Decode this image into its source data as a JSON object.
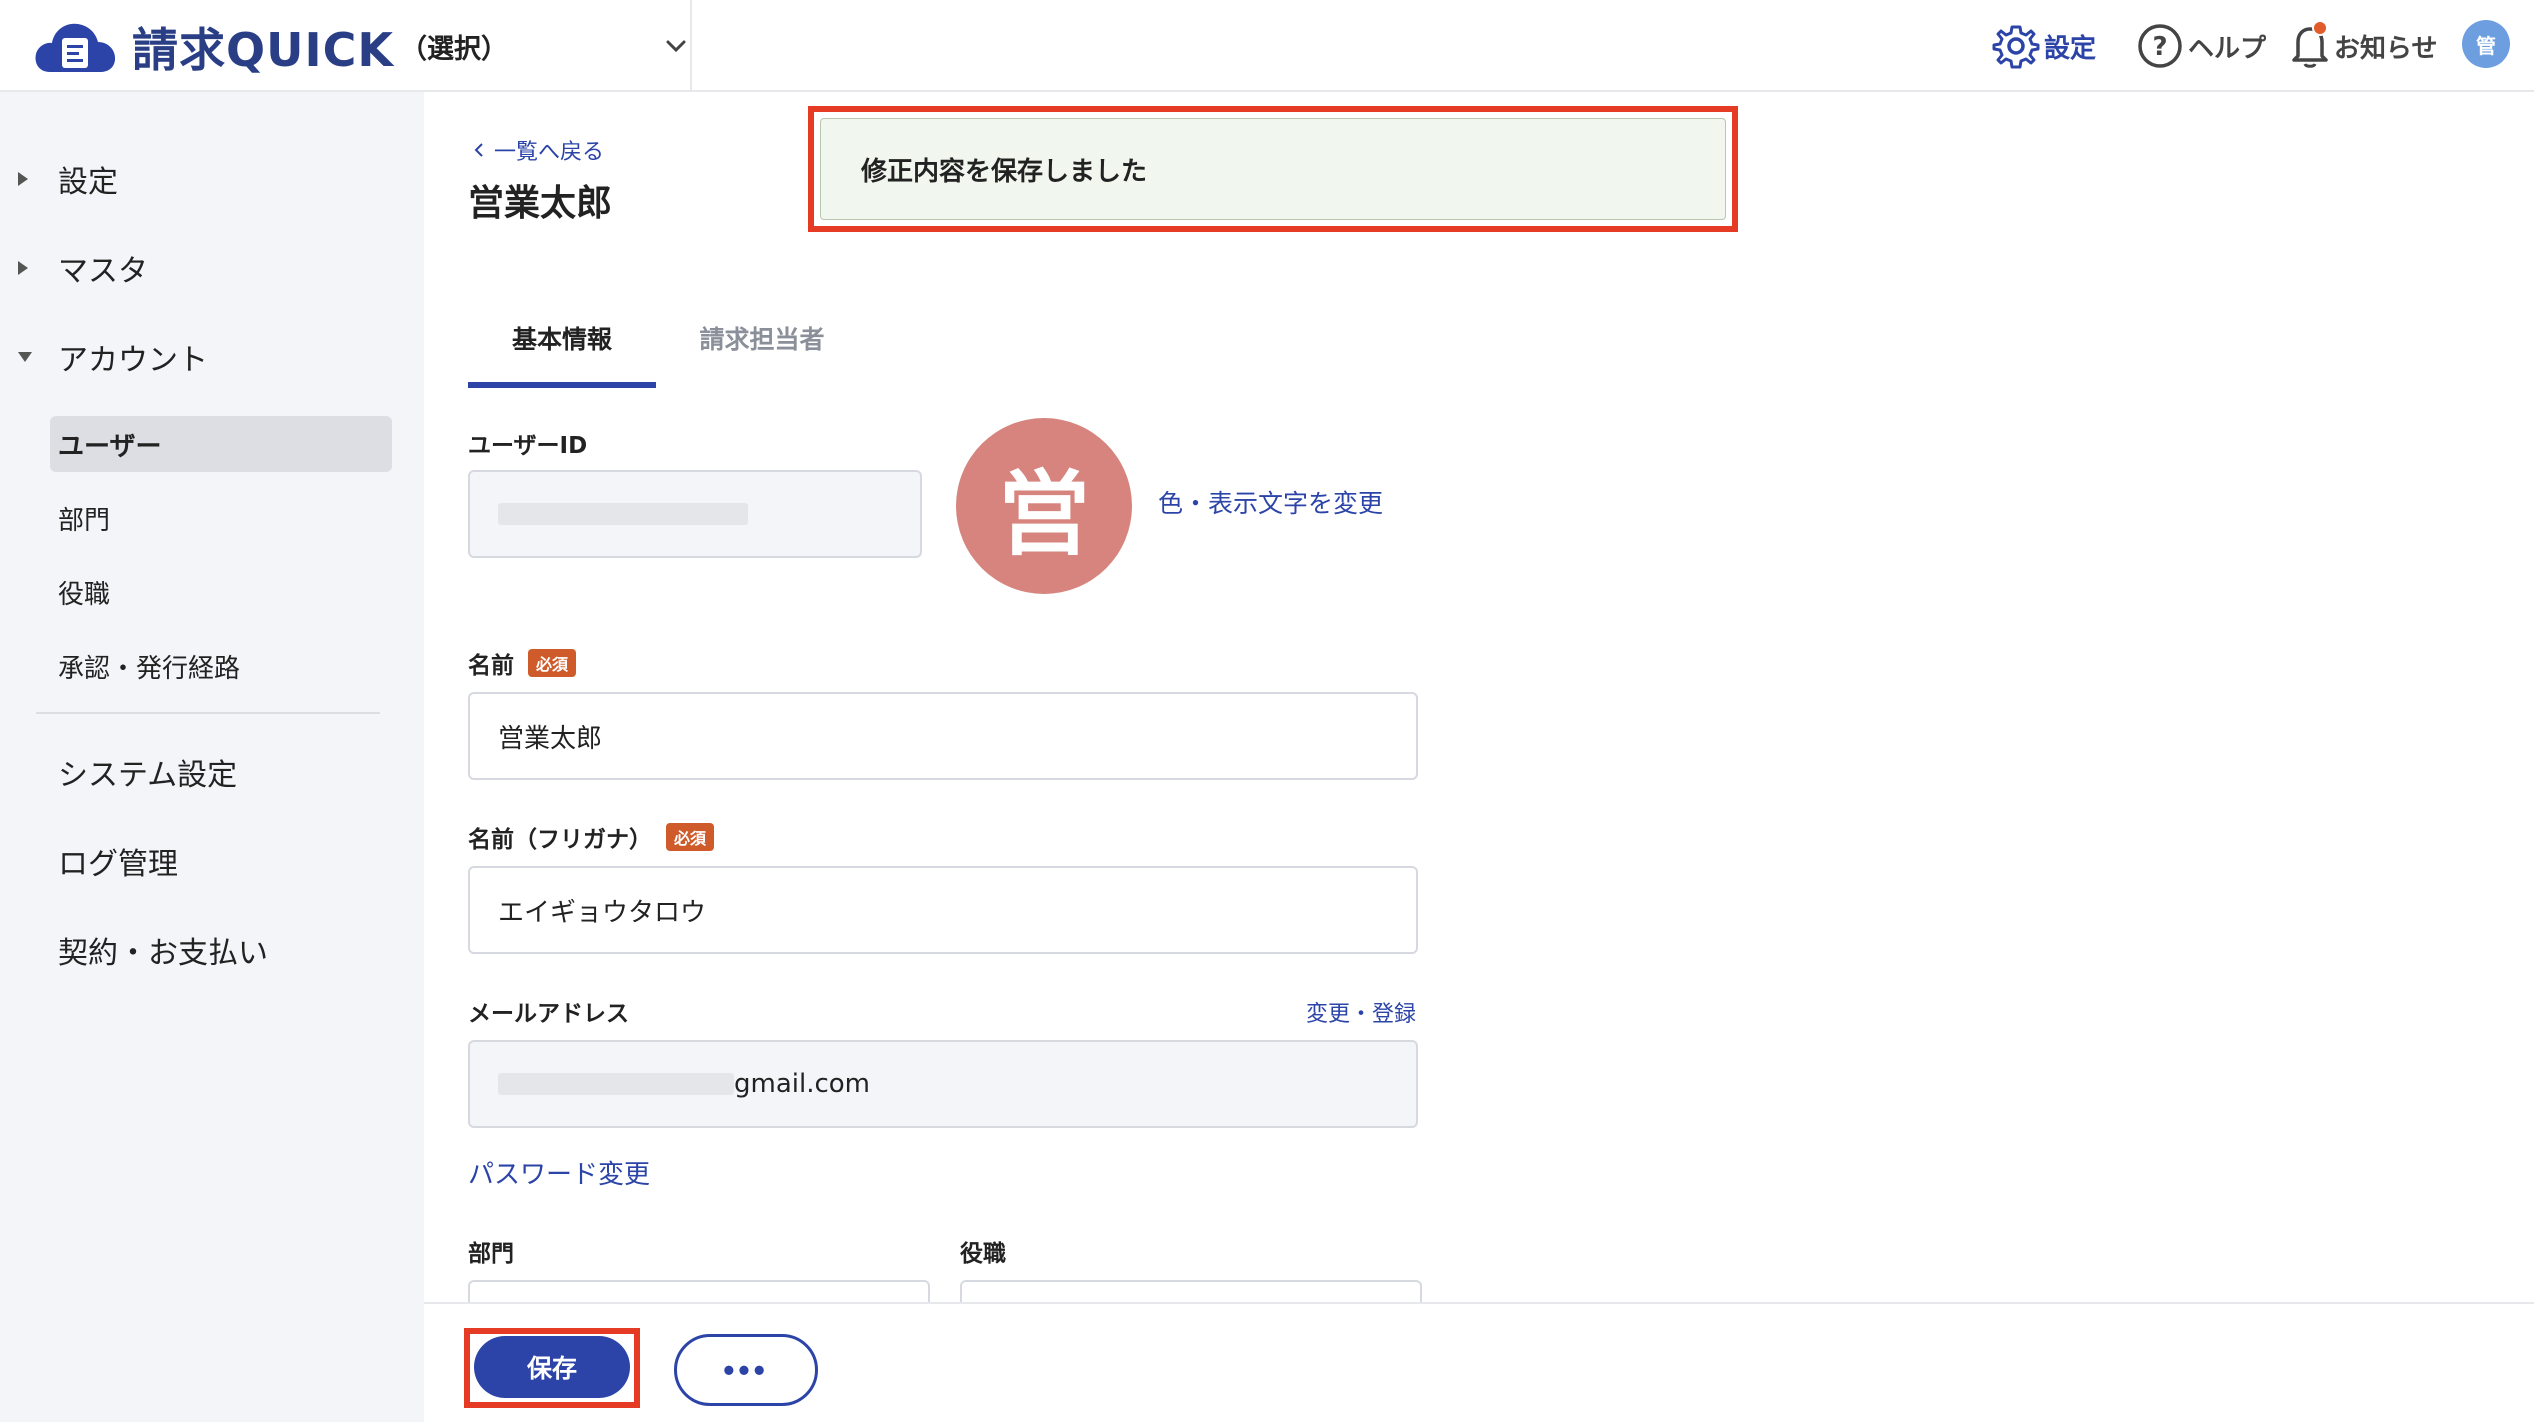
{
  "header": {
    "brand": "請求QUICK",
    "org_select": "（選択）",
    "settings_label": "設定",
    "help_label": "ヘルプ",
    "notice_label": "お知らせ",
    "avatar_initial": "管"
  },
  "sidebar": {
    "items": [
      {
        "label": "設定",
        "expander": "collapsed"
      },
      {
        "label": "マスタ",
        "expander": "collapsed"
      },
      {
        "label": "アカウント",
        "expander": "expanded"
      }
    ],
    "sub_items": [
      {
        "label": "ユーザー",
        "active": true
      },
      {
        "label": "部門"
      },
      {
        "label": "役職"
      },
      {
        "label": "承認・発行経路"
      }
    ],
    "bottom_items": [
      {
        "label": "システム設定"
      },
      {
        "label": "ログ管理"
      },
      {
        "label": "契約・お支払い"
      }
    ]
  },
  "main": {
    "back_link": "一覧へ戻る",
    "title": "営業太郎",
    "toast": "修正内容を保存しました",
    "tabs": [
      {
        "label": "基本情報",
        "active": true
      },
      {
        "label": "請求担当者"
      }
    ],
    "user_id": {
      "label": "ユーザーID"
    },
    "avatar": {
      "initial": "営",
      "color": "#d6847d",
      "change_link": "色・表示文字を変更"
    },
    "name": {
      "label": "名前",
      "required": "必須",
      "value": "営業太郎"
    },
    "kana": {
      "label": "名前（フリガナ）",
      "required": "必須",
      "value": "エイギョウタロウ"
    },
    "email": {
      "label": "メールアドレス",
      "change_link": "変更・登録",
      "value_visible": "gmail.com"
    },
    "password_link": "パスワード変更",
    "department": {
      "label": "部門"
    },
    "position": {
      "label": "役職"
    }
  },
  "footer": {
    "save_label": "保存",
    "more_label": "•••"
  },
  "colors": {
    "accent": "#2c44a8",
    "highlight": "#e53b24",
    "required_badge": "#cf5a2a",
    "toast_bg": "#f1f6ee"
  }
}
